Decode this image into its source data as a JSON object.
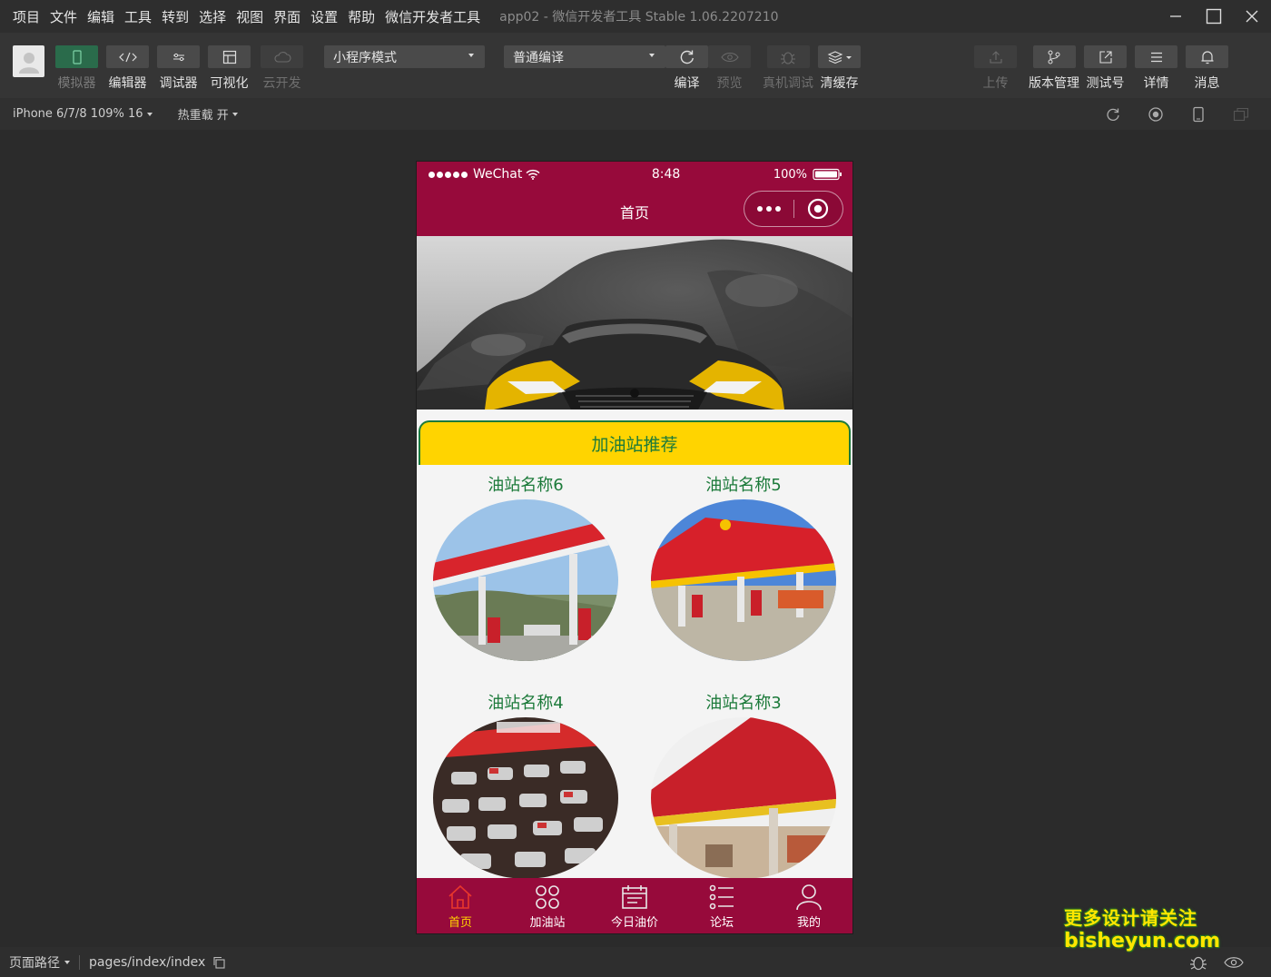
{
  "menubar": {
    "items": [
      "项目",
      "文件",
      "编辑",
      "工具",
      "转到",
      "选择",
      "视图",
      "界面",
      "设置",
      "帮助",
      "微信开发者工具"
    ],
    "app_title": "app02 - 微信开发者工具 Stable 1.06.2207210"
  },
  "toolbar": {
    "simulator": "模拟器",
    "editor": "编辑器",
    "debugger": "调试器",
    "visual": "可视化",
    "cloud": "云开发",
    "mode_select": "小程序模式",
    "compile_select": "普通编译",
    "compile": "编译",
    "preview": "预览",
    "real_debug": "真机调试",
    "clear_cache": "清缓存",
    "upload": "上传",
    "version": "版本管理",
    "test_account": "测试号",
    "details": "详情",
    "messages": "消息"
  },
  "subbar": {
    "device": "iPhone 6/7/8 109% 16",
    "hot_reload": "热重载 开"
  },
  "phone": {
    "status": {
      "carrier": "WeChat",
      "time": "8:48",
      "battery": "100%"
    },
    "nav_title": "首页",
    "section_title": "加油站推荐",
    "stations": [
      {
        "name": "油站名称6"
      },
      {
        "name": "油站名称5"
      },
      {
        "name": "油站名称4"
      },
      {
        "name": "油站名称3"
      }
    ],
    "tabs": [
      {
        "label": "首页"
      },
      {
        "label": "加油站"
      },
      {
        "label": "今日油价"
      },
      {
        "label": "论坛"
      },
      {
        "label": "我的"
      }
    ],
    "active_tab": "首页"
  },
  "bottombar": {
    "route_label": "页面路径",
    "route_path": "pages/index/index"
  },
  "watermark": {
    "line1": "更多设计请关注",
    "line2": "bisheyun.com"
  },
  "colors": {
    "theme": "#970a3b",
    "accent": "#ffd400",
    "green": "#1c7a3a"
  }
}
